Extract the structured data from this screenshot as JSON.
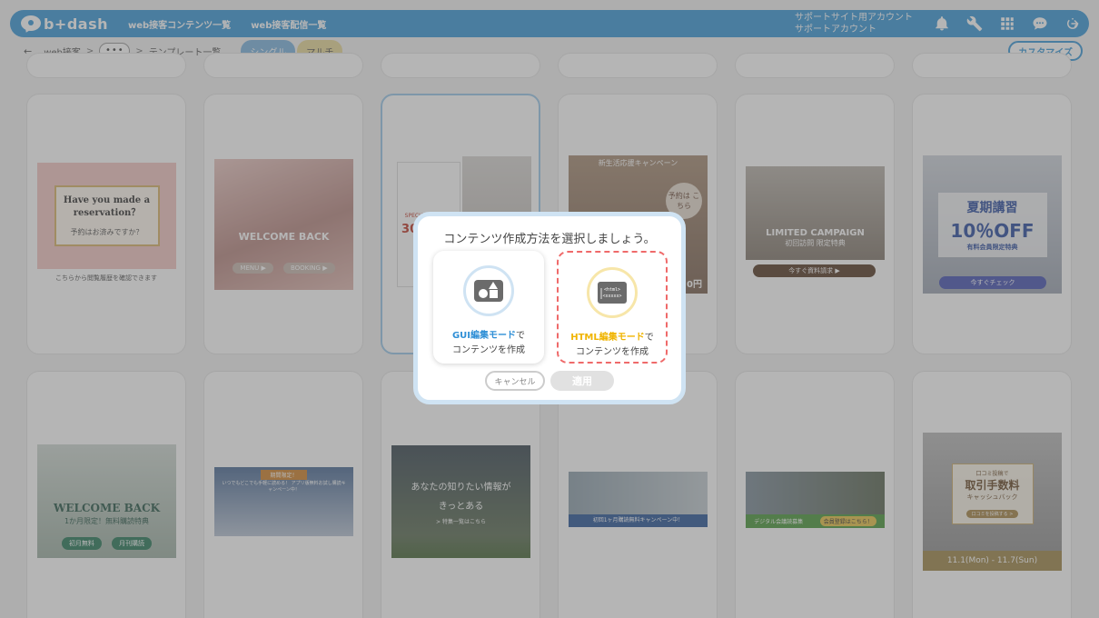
{
  "header": {
    "logo": "b+dash",
    "nav": [
      "web接客コンテンツ一覧",
      "web接客配信一覧"
    ],
    "account_line1": "サポートサイト用アカウント",
    "account_line2": "サポートアカウント",
    "icons": [
      "bell-icon",
      "wrench-icon",
      "apps-grid-icon",
      "chat-icon",
      "logout-icon"
    ]
  },
  "breadcrumb": {
    "back": "←",
    "root": "web接客",
    "sep": ">",
    "ellipsis": "•••",
    "current": "テンプレート一覧"
  },
  "tabs": [
    "シングル",
    "マルチ"
  ],
  "customize_label": "カスタマイズ",
  "templates": [
    {
      "title": "Have you made a reservation？",
      "sub": "予約はお済みですか？",
      "caption": "こちらから閲覧履歴を確認できます"
    },
    {
      "title": "WELCOME BACK",
      "buttons": [
        "MENU ▶",
        "BOOKING ▶"
      ]
    },
    {
      "title": "SPECIAL COUPON",
      "sub": "30%OFF"
    },
    {
      "title": "新生活応援キャンペーン",
      "sub": "予約は こちら",
      "price": "0円"
    },
    {
      "title": "LIMITED CAMPAIGN",
      "sub": "初回訪問 限定特典",
      "button": "今すぐ資料請求 ▶"
    },
    {
      "title": "夏期講習",
      "sub": "10％OFF",
      "sub2": "有料会員限定特典",
      "button": "今すぐチェック"
    },
    {
      "title": "WELCOME BACK",
      "sub": "1か月限定！無料購読特典",
      "buttons": [
        "初月無料",
        "月刊購読"
      ]
    },
    {
      "title": "期間限定！",
      "sub": "いつでもどこでも手軽に読める！ アプリ版無料お試し購読キャンペーン中！"
    },
    {
      "title": "あなたの知りたい情報が",
      "sub": "きっとある",
      "sub2": "> 特集一覧はこちら"
    },
    {
      "title": "初回1ヶ月購読無料キャンペーン中！"
    },
    {
      "title": "デジタル会議読募集",
      "button": "会員登録はこちら！"
    },
    {
      "title": "取引手数料",
      "sub": "口コミ投稿で",
      "sub2": "キャッシュバック",
      "button": "口コミを投稿する >",
      "footer": "11.1(Mon) - 11.7(Sun)"
    }
  ],
  "modal": {
    "title": "コンテンツ作成方法を選択しましょう。",
    "gui_highlight": "GUI編集モード",
    "gui_suffix": "で",
    "gui_line2": "コンテンツを作成",
    "html_highlight": "HTML編集モード",
    "html_suffix": "で",
    "html_line2": "コンテンツを作成",
    "html_icon_text": "<html>",
    "cancel": "キャンセル",
    "apply": "適用"
  },
  "colors": {
    "brand": "#3d9ad8",
    "dashed": "#ef6a6a",
    "html_accent": "#f0b400",
    "gui_accent": "#2f8fd6"
  }
}
